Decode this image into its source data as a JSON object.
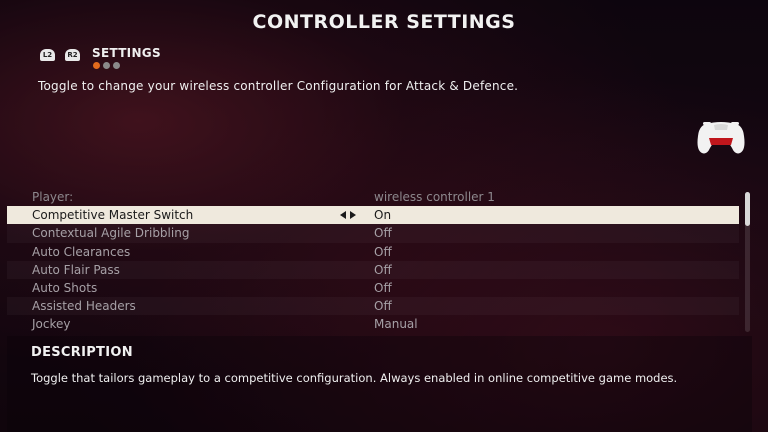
{
  "header": {
    "title": "CONTROLLER SETTINGS",
    "bumpers": {
      "left": "L2",
      "right": "R2"
    },
    "breadcrumb": "SETTINGS",
    "page_dots": 3,
    "active_dot": 1,
    "subtitle": "Toggle to change your wireless controller Configuration for Attack & Defence."
  },
  "colors": {
    "accent": "#e26a1d",
    "selected_row_bg": "#efe9dd"
  },
  "icons": {
    "controller": "gamepad-icon"
  },
  "settings": {
    "header_row": {
      "label": "Player:",
      "value": "wireless controller 1"
    },
    "items": [
      {
        "label": "Competitive Master Switch",
        "value": "On",
        "selected": true
      },
      {
        "label": "Contextual Agile Dribbling",
        "value": "Off"
      },
      {
        "label": "Auto Clearances",
        "value": "Off"
      },
      {
        "label": "Auto Flair Pass",
        "value": "Off"
      },
      {
        "label": "Auto Shots",
        "value": "Off"
      },
      {
        "label": "Assisted Headers",
        "value": "Off"
      },
      {
        "label": "Jockey",
        "value": "Manual"
      }
    ]
  },
  "description": {
    "heading": "DESCRIPTION",
    "text": "Toggle that tailors gameplay to a competitive configuration. Always enabled in online competitive game modes."
  }
}
